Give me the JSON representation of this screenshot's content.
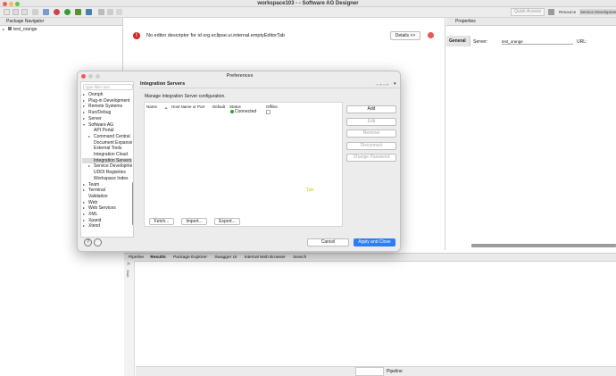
{
  "window": {
    "title": "workspace103 - - Software AG Designer"
  },
  "toolbar": {
    "quick_access": "Quick Access",
    "perspectives": [
      "Resource",
      "Service Development"
    ]
  },
  "left_pane": {
    "tab_label": "Package Navigator",
    "tree": [
      "test_orange"
    ]
  },
  "editor": {
    "message": "No editor descriptor for id org.eclipse.ui.internal.emptyEditorTab",
    "details_button": "Details >>"
  },
  "properties": {
    "tab_label": "Properties",
    "section": "General",
    "server_label": "Server:",
    "server_value": "test_orange",
    "url_label": "URL:"
  },
  "bottom": {
    "tabs": [
      "Pipeline",
      "Results",
      "Package Explorer",
      "Swagger UI",
      "Internal Web Browser",
      "Search"
    ],
    "side_label": "Start",
    "footer_tab": "Pipeline"
  },
  "dialog": {
    "title": "Preferences",
    "filter_placeholder": "type filter text",
    "tree": [
      {
        "label": "Oomph",
        "level": 0,
        "arrow": "right"
      },
      {
        "label": "Plug-in Development",
        "level": 0,
        "arrow": "right"
      },
      {
        "label": "Remote Systems",
        "level": 0,
        "arrow": "right"
      },
      {
        "label": "Run/Debug",
        "level": 0,
        "arrow": "right"
      },
      {
        "label": "Server",
        "level": 0,
        "arrow": "right"
      },
      {
        "label": "Software AG",
        "level": 0,
        "arrow": "down"
      },
      {
        "label": "API Portal",
        "level": 1,
        "arrow": ""
      },
      {
        "label": "Command Central",
        "level": 1,
        "arrow": "right"
      },
      {
        "label": "Document Expansio",
        "level": 1,
        "arrow": ""
      },
      {
        "label": "External Tools",
        "level": 1,
        "arrow": ""
      },
      {
        "label": "Integration Cloud",
        "level": 1,
        "arrow": ""
      },
      {
        "label": "Integration Servers",
        "level": 1,
        "arrow": "",
        "selected": true
      },
      {
        "label": "Service Developme",
        "level": 1,
        "arrow": "right"
      },
      {
        "label": "UDDI Registries",
        "level": 1,
        "arrow": ""
      },
      {
        "label": "Workspace Index",
        "level": 1,
        "arrow": ""
      },
      {
        "label": "Team",
        "level": 0,
        "arrow": "right"
      },
      {
        "label": "Terminal",
        "level": 0,
        "arrow": "right"
      },
      {
        "label": "Validation",
        "level": 0,
        "arrow": ""
      },
      {
        "label": "Web",
        "level": 0,
        "arrow": "right"
      },
      {
        "label": "Web Services",
        "level": 0,
        "arrow": "right"
      },
      {
        "label": "XML",
        "level": 0,
        "arrow": "right"
      },
      {
        "label": "Xpand",
        "level": 0,
        "arrow": "right"
      },
      {
        "label": "Xtend",
        "level": 0,
        "arrow": "right"
      }
    ],
    "page_title": "Integration Servers",
    "description": "Manage Integration Server configuration.",
    "columns": [
      "Name",
      "Host Name or Port",
      "Default",
      "Status",
      "Offline"
    ],
    "row": {
      "status": "Connected"
    },
    "side_buttons": [
      "Add",
      "Edit",
      "Remove",
      "Disconnect",
      "Change Password"
    ],
    "bottom_buttons": [
      "Fetch...",
      "Import...",
      "Export..."
    ],
    "cancel": "Cancel",
    "apply_close": "Apply and Close",
    "cursor_hint": "Tab"
  }
}
